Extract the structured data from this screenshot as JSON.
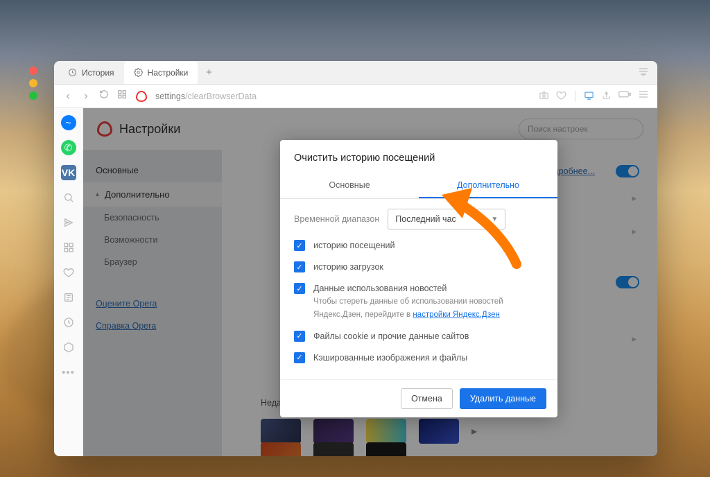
{
  "tabs": {
    "history": "История",
    "settings": "Настройки"
  },
  "addressbar": {
    "prefix": "settings",
    "path": "/clearBrowserData"
  },
  "settings": {
    "title": "Настройки",
    "search_placeholder": "Поиск настроек",
    "sidebar": {
      "basic": "Основные",
      "advanced": "Дополнительно",
      "security": "Безопасность",
      "features": "Возможности",
      "browser": "Браузер",
      "rate": "Оцените Opera",
      "help": "Справка Opera"
    },
    "main": {
      "more_link": "одробнее...",
      "recent_label": "Недавние фоновые рисунки"
    }
  },
  "modal": {
    "title": "Очистить историю посещений",
    "tab_basic": "Основные",
    "tab_advanced": "Дополнительно",
    "range_label": "Временной диапазон",
    "range_value": "Последний час",
    "items": {
      "history": "историю посещений",
      "downloads": "историю загрузок",
      "news_title": "Данные использования новостей",
      "news_sub_prefix": "Чтобы стереть данные об использовании новостей Яндекс.Дзен, перейдите в ",
      "news_sub_link": "настройки Яндекс.Дзен",
      "cookies": "Файлы cookie и прочие данные сайтов",
      "cache": "Кэшированные изображения и файлы"
    },
    "cancel": "Отмена",
    "confirm": "Удалить данные"
  }
}
